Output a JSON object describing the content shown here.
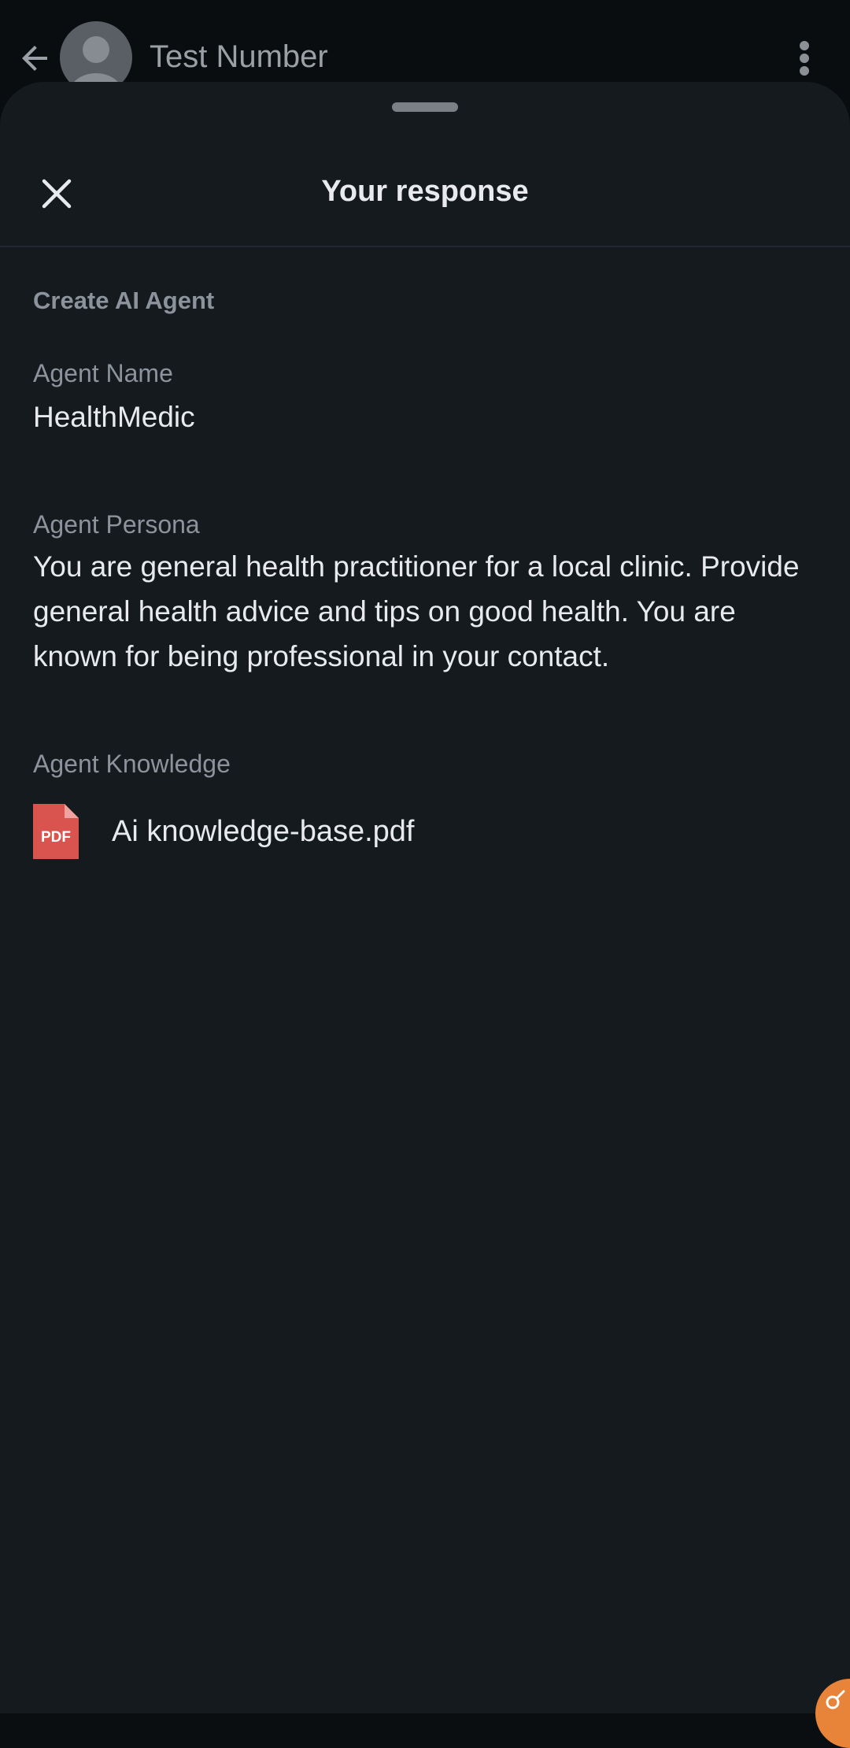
{
  "header": {
    "contact_name": "Test Number",
    "back_icon": "arrow-back-icon",
    "more_icon": "more-vert-icon"
  },
  "sheet": {
    "title": "Your response",
    "close_icon": "close-icon",
    "section_title": "Create AI Agent",
    "fields": [
      {
        "label": "Agent Name",
        "value": "HealthMedic"
      },
      {
        "label": "Agent Persona",
        "value": "You are general health practitioner for a local clinic. Provide general health advice and tips on good health. You are known for being professional in your contact."
      },
      {
        "label": "Agent Knowledge",
        "file": {
          "name": "Ai knowledge-base.pdf",
          "type": "PDF"
        }
      }
    ]
  },
  "colors": {
    "sheet_bg": "#151a1f",
    "accent_pdf": "#d9534f",
    "badge": "#e8833a"
  }
}
